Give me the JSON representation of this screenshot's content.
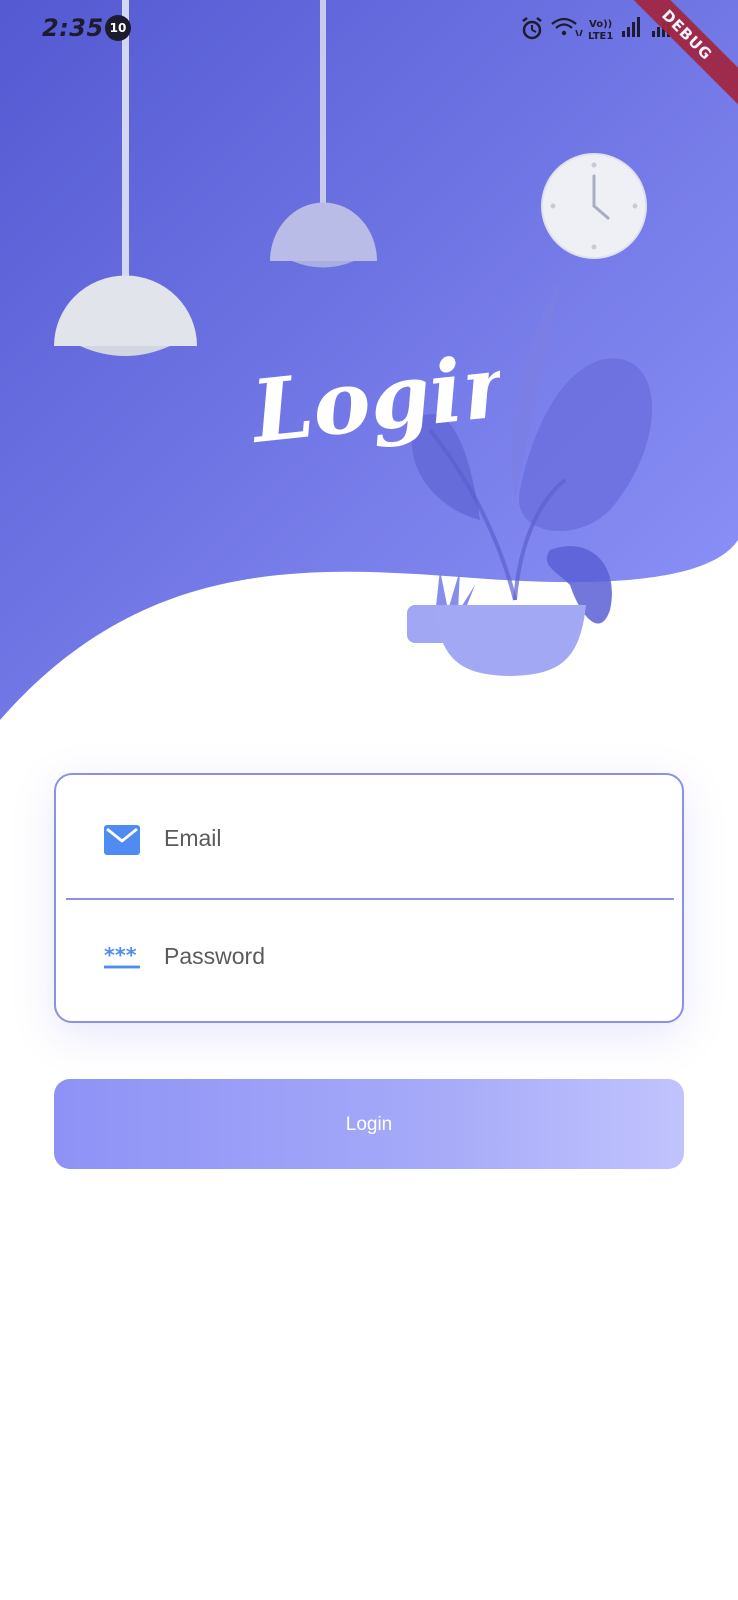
{
  "status_bar": {
    "time": "2:35",
    "notification_count": "10",
    "debug_label": "DEBUG",
    "network_label_top": "Vo))",
    "network_label_bottom": "LTE1"
  },
  "header": {
    "title": "Login"
  },
  "form": {
    "email": {
      "placeholder": "Email",
      "value": ""
    },
    "password": {
      "placeholder": "Password",
      "value": ""
    }
  },
  "login_button": {
    "label": "Login"
  },
  "colors": {
    "gradient_start": "#5459d2",
    "gradient_end": "#8f95f9",
    "accent_blue": "#4e8cf2",
    "border": "#8c90e6",
    "button_start": "#8e92f6",
    "button_end": "#c1c3fd",
    "debug_ribbon": "#a3253f"
  },
  "icons": {
    "email": "envelope-icon",
    "password": "password-dots-icon",
    "alarm": "alarm-icon",
    "wifi": "wifi-icon",
    "signal": "signal-icon",
    "lamp": "pendant-lamp-illustration",
    "clock": "wall-clock-illustration",
    "plant": "potted-plant-illustration"
  }
}
